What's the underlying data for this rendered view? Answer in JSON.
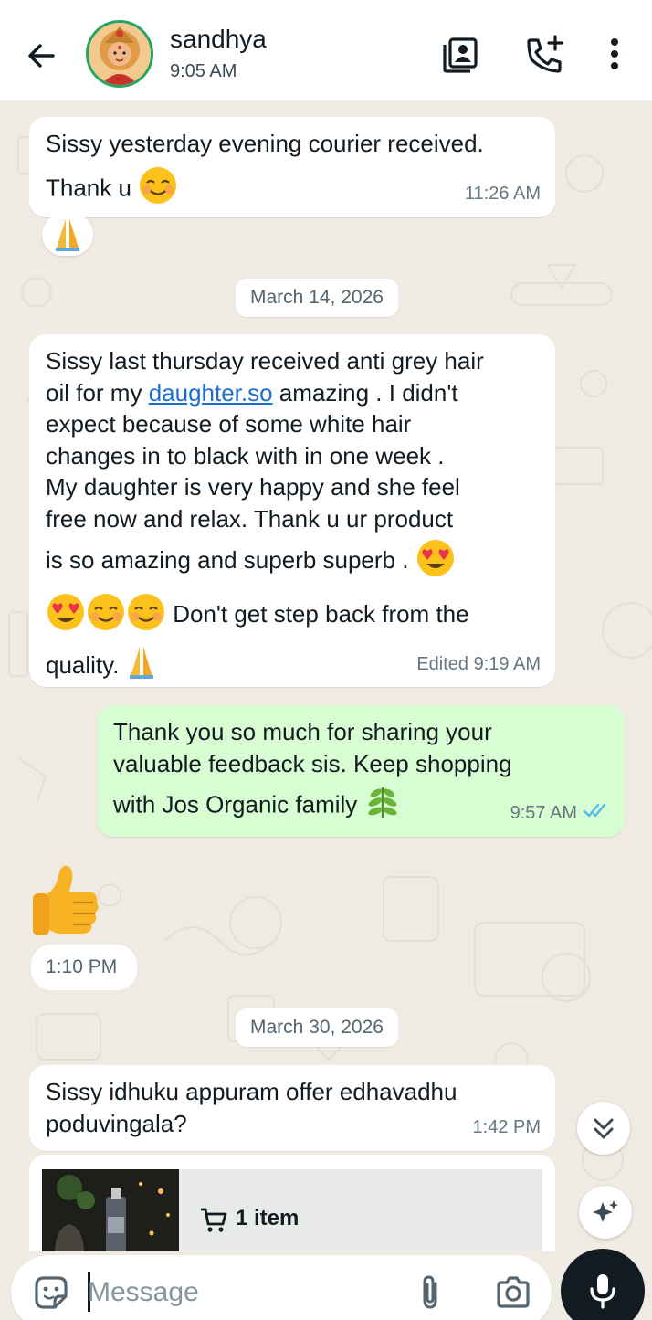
{
  "header": {
    "contact_name": "sandhya",
    "last_seen": "9:05 AM",
    "icons": [
      "back-arrow-icon",
      "contact-card-icon",
      "add-call-icon",
      "more-vert-icon"
    ]
  },
  "messages": [
    {
      "direction": "incoming",
      "lines": [
        "Sissy yesterday evening courier received.",
        "Thank u"
      ],
      "emoji_tail": "smiling-face-icon",
      "time": "11:26 AM",
      "reaction": "folded-hands-icon"
    },
    {
      "date_separator": "March 14, 2026"
    },
    {
      "direction": "incoming",
      "lines": [
        "Sissy last thursday received anti grey hair",
        "oil for my ",
        "daughter.so",
        " amazing . I didn't",
        "expect because of  some white hair",
        "changes in to black with in one week .",
        "My daughter is very happy and she feel",
        "free now and relax. Thank u ur product",
        "is so amazing and superb superb . ",
        " Don't get step back  from the",
        "quality."
      ],
      "meta": "Edited 9:19 AM"
    },
    {
      "direction": "outgoing",
      "lines": [
        "Thank you so much for sharing your",
        "valuable feedback sis. Keep shopping",
        "with Jos Organic family "
      ],
      "time": "9:57 AM",
      "status": "read-double-tick-icon"
    },
    {
      "direction": "incoming",
      "sticker": "thumbs-up-icon",
      "time": "1:10 PM"
    },
    {
      "date_separator": "March 30, 2026"
    },
    {
      "direction": "incoming",
      "lines": [
        "Sissy idhuku appuram offer edhavadhu",
        "poduvingala?"
      ],
      "time": "1:42 PM"
    },
    {
      "direction": "incoming",
      "cart": {
        "label": "1 item",
        "icon": "cart-icon"
      }
    }
  ],
  "composer": {
    "placeholder": "Message",
    "icons": [
      "sticker-icon",
      "attach-icon",
      "camera-icon",
      "mic-icon"
    ]
  },
  "floating": [
    "scroll-down-icon",
    "ai-sparkle-icon"
  ],
  "colors": {
    "chat_bg": "#efeae2",
    "incoming_bubble": "#ffffff",
    "outgoing_bubble": "#d9fdd3",
    "link": "#1f6fd1",
    "read_tick": "#53bdeb",
    "avatar_ring": "#25a55f"
  }
}
